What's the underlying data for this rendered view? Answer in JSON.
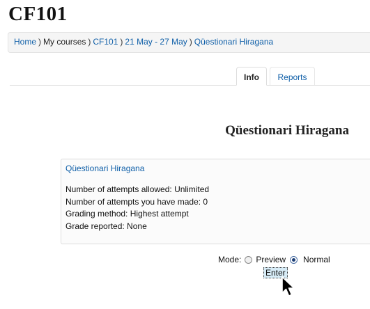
{
  "course": {
    "title": "CF101"
  },
  "breadcrumb": {
    "items": [
      {
        "label": "Home",
        "link": true
      },
      {
        "label": "My courses",
        "link": false
      },
      {
        "label": "CF101",
        "link": true
      },
      {
        "label": "21 May - 27 May",
        "link": true
      },
      {
        "label": "Qüestionari Hiragana",
        "link": true
      }
    ],
    "separator": ")"
  },
  "tabs": [
    {
      "label": "Info",
      "active": true
    },
    {
      "label": "Reports",
      "active": false
    }
  ],
  "quiz": {
    "heading": "Qüestionari Hiragana",
    "box_title": "Qüestionari Hiragana",
    "lines": [
      "Number of attempts allowed: Unlimited",
      "Number of attempts you have made: 0",
      "Grading method: Highest attempt",
      "Grade reported: None"
    ]
  },
  "mode": {
    "label": "Mode:",
    "options": [
      {
        "label": "Preview",
        "checked": false
      },
      {
        "label": "Normal",
        "checked": true
      }
    ]
  },
  "enter_button": {
    "label": "Enter"
  },
  "colors": {
    "link": "#0f5fa8",
    "breadcrumb_bg": "#f5f5f5",
    "button_bg": "#d7ecf7"
  }
}
